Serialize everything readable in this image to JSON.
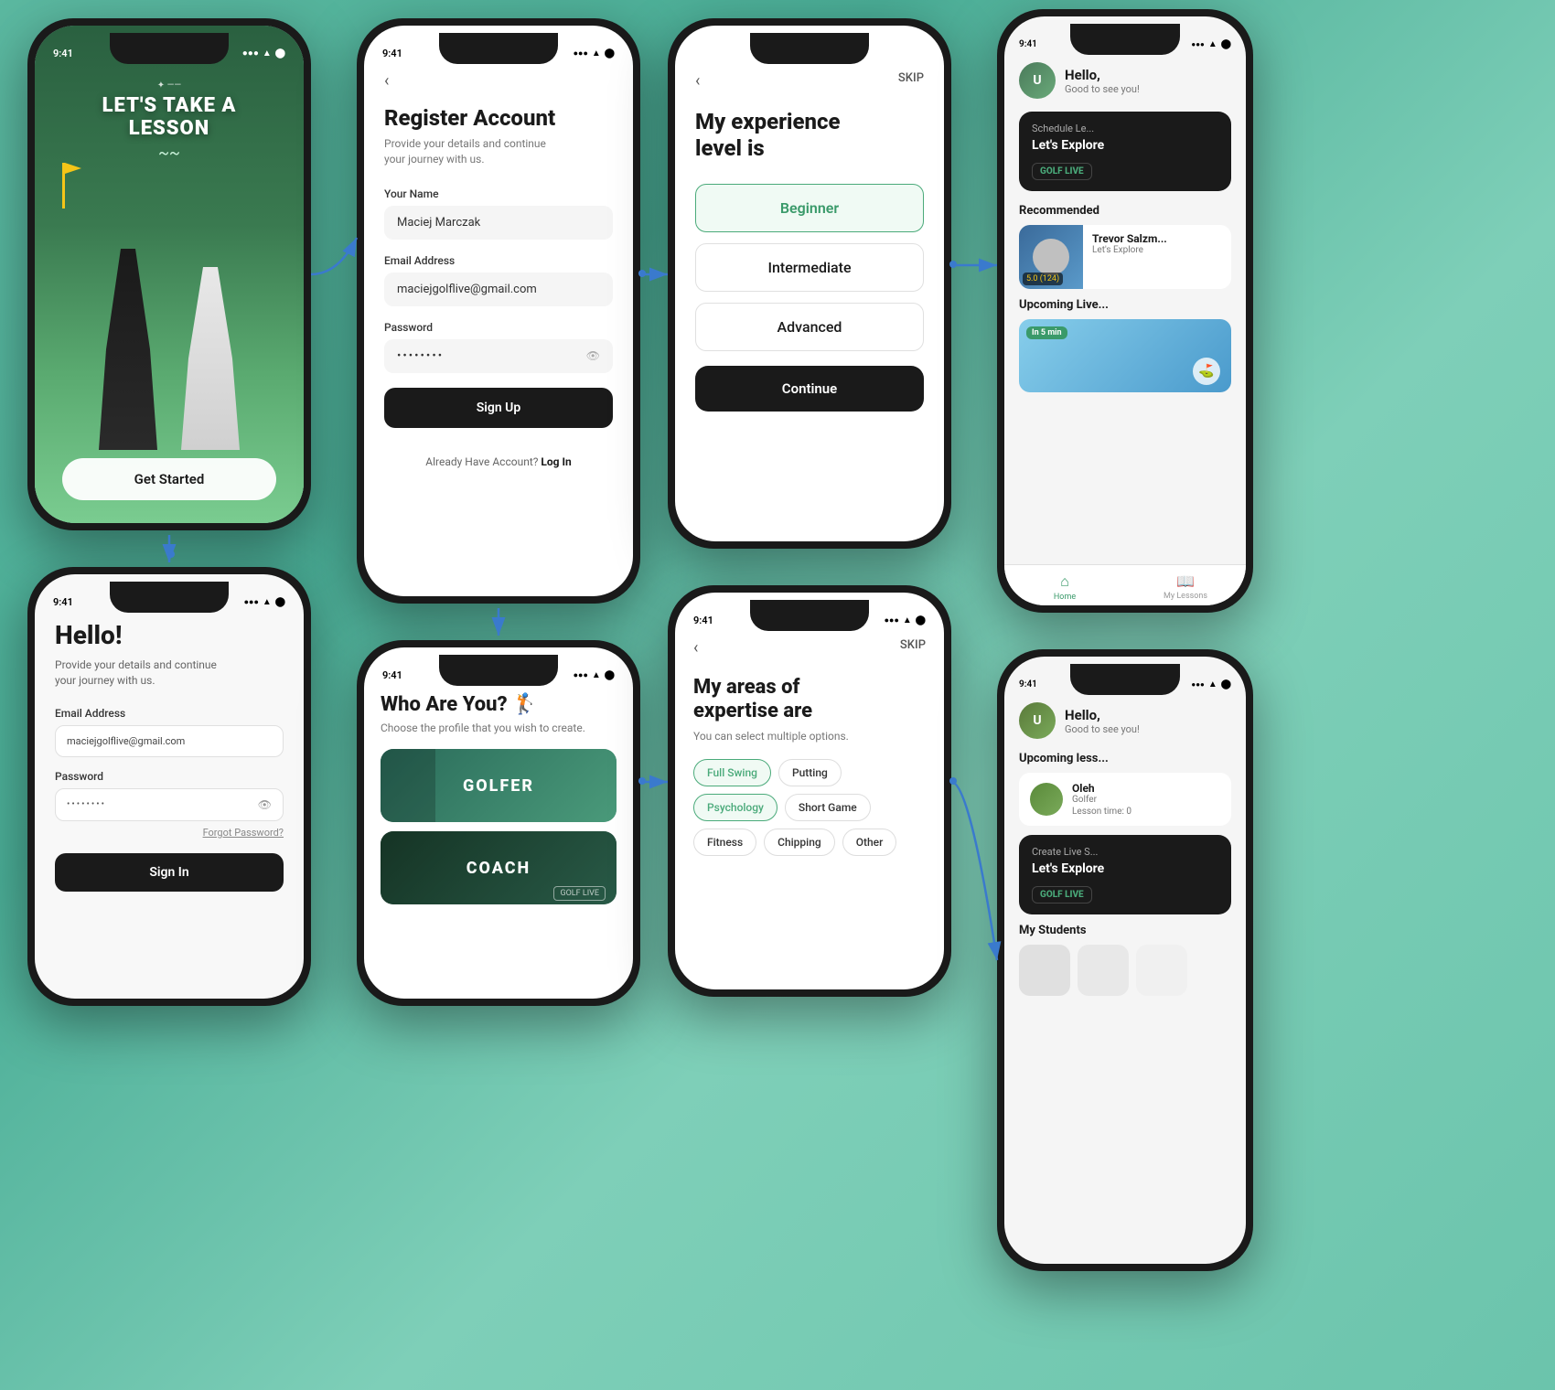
{
  "phone1": {
    "status_time": "9:41",
    "hero_decoration": "✦ ✦",
    "title_line1": "LET'S TAKE A",
    "title_line2": "LESSON",
    "get_started": "Get Started"
  },
  "phone2": {
    "status_time": "9:41",
    "title": "Hello!",
    "subtitle_line1": "Provide your details and continue",
    "subtitle_line2": "your journey with us.",
    "email_label": "Email Address",
    "email_value": "maciejgolflive@gmail.com",
    "password_label": "Password",
    "password_placeholder": "••••••••",
    "forgot_password": "Forgot Password?",
    "sign_in_label": "Sign In"
  },
  "phone3": {
    "status_time": "9:41",
    "back_icon": "‹",
    "title": "Register Account",
    "subtitle_line1": "Provide your details and continue",
    "subtitle_line2": "your journey with us.",
    "name_label": "Your Name",
    "name_value": "Maciej Marczak",
    "email_label": "Email Address",
    "email_value": "maciejgolflive@gmail.com",
    "password_label": "Password",
    "password_dots": "••••••••",
    "signup_label": "Sign Up",
    "already_text": "Already Have Account?",
    "login_link": "Log In"
  },
  "phone4": {
    "status_time": "9:41",
    "title": "Who Are You? 🏌",
    "subtitle": "Choose the profile that you wish to create.",
    "golfer_label": "GOLFER",
    "coach_label": "COACH"
  },
  "phone5": {
    "back_icon": "‹",
    "skip_label": "SKIP",
    "title_line1": "My experience",
    "title_line2": "level is",
    "beginner": "Beginner",
    "intermediate": "Intermediate",
    "advanced": "Advanced",
    "continue_label": "Continue"
  },
  "phone6": {
    "status_time": "9:41",
    "back_icon": "‹",
    "skip_label": "SKIP",
    "title_line1": "My areas of",
    "title_line2": "expertise are",
    "subtitle": "You can select multiple options.",
    "tags": [
      {
        "label": "Full Swing",
        "active": true
      },
      {
        "label": "Putting",
        "active": false
      },
      {
        "label": "Psychology",
        "active": true
      },
      {
        "label": "Short Game",
        "active": false
      },
      {
        "label": "Fitness",
        "active": false
      },
      {
        "label": "Chipping",
        "active": false
      },
      {
        "label": "Other",
        "active": false
      }
    ]
  },
  "phone7": {
    "status_time": "9:41",
    "hello_text": "Hello,",
    "good_to": "Good to see you!",
    "schedule_label": "Schedule Le...",
    "schedule_subtitle": "Let's Explore",
    "golf_live_badge": "GOLF LIVE",
    "recommended_title": "Recommended",
    "instructor_name": "Trevor Salzm...",
    "instructor_sub": "Let's Explore",
    "instructor_rating": "5.0 (124)",
    "upcoming_title": "Upcoming Live...",
    "in_5_min": "In 5 min",
    "nav_home": "Home",
    "nav_lessons": "My Lessons"
  },
  "phone8": {
    "status_time": "9:41",
    "hello_text": "Hello,",
    "good_to": "Good to see you!",
    "upcoming_lessons": "Upcoming less...",
    "lesson_name": "Oleh",
    "lesson_role": "Golfer",
    "lesson_time": "Lesson time: 0",
    "create_label": "Create Live S...",
    "create_subtitle": "Let's Explore",
    "golf_live_badge": "GOLF LIVE",
    "my_students": "My Students"
  },
  "colors": {
    "green_accent": "#4aaa7a",
    "dark": "#1a1a1a",
    "arrow_blue": "#3a7acd"
  }
}
